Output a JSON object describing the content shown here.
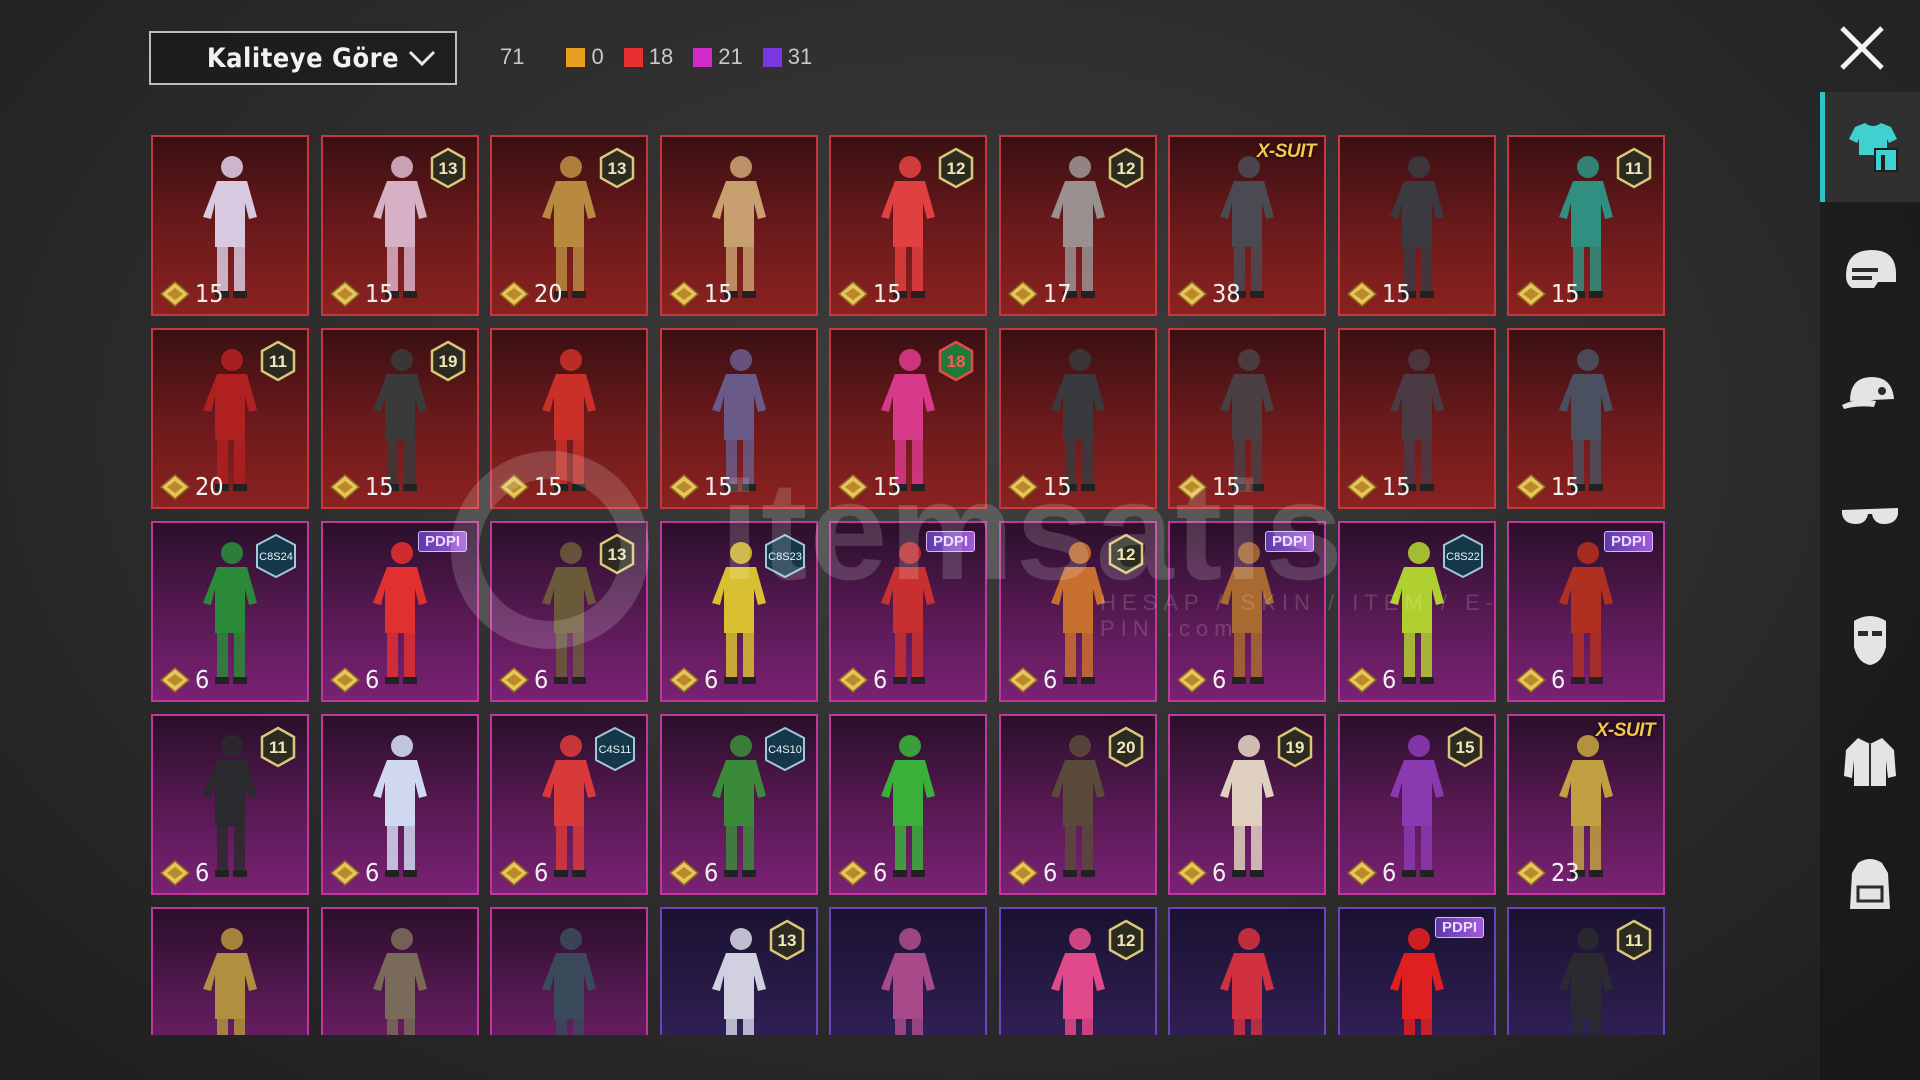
{
  "toolbar": {
    "sort_label": "Kaliteye Göre",
    "total_count": "71",
    "rarity_counts": [
      {
        "color": "#e8a020",
        "count": "0"
      },
      {
        "color": "#e83030",
        "count": "18"
      },
      {
        "color": "#d42ac8",
        "count": "21"
      },
      {
        "color": "#7a36e0",
        "count": "31"
      }
    ]
  },
  "watermark": {
    "brand": "itemsatis",
    "tagline": "HESAP / SKIN / ITEM / E-PIN .com"
  },
  "items": [
    {
      "rarity": "red",
      "price": "15",
      "badge": "",
      "figure": "#d9c9e0"
    },
    {
      "rarity": "red",
      "price": "15",
      "badge": "13",
      "figure": "#d8b0c6"
    },
    {
      "rarity": "red",
      "price": "20",
      "badge": "13",
      "figure": "#b88a40"
    },
    {
      "rarity": "red",
      "price": "15",
      "badge": "",
      "figure": "#c8a070"
    },
    {
      "rarity": "red",
      "price": "15",
      "badge": "12",
      "figure": "#e04040"
    },
    {
      "rarity": "red",
      "price": "17",
      "badge": "12",
      "figure": "#9a9090"
    },
    {
      "rarity": "red",
      "price": "38",
      "badge": "X-SUIT",
      "figure": "#4a4a52"
    },
    {
      "rarity": "red",
      "price": "15",
      "badge": "",
      "figure": "#3a3a40"
    },
    {
      "rarity": "red",
      "price": "15",
      "badge": "11",
      "figure": "#2f8f80"
    },
    {
      "rarity": "red",
      "price": "20",
      "badge": "11",
      "figure": "#b02020"
    },
    {
      "rarity": "red",
      "price": "15",
      "badge": "19",
      "figure": "#3a3a3a"
    },
    {
      "rarity": "red",
      "price": "15",
      "badge": "",
      "figure": "#c83028"
    },
    {
      "rarity": "red",
      "price": "15",
      "badge": "",
      "figure": "#6a5a8a"
    },
    {
      "rarity": "red",
      "price": "15",
      "badge": "18",
      "figure": "#d83a8a"
    },
    {
      "rarity": "red",
      "price": "15",
      "badge": "",
      "figure": "#3a3a3e"
    },
    {
      "rarity": "red",
      "price": "15",
      "badge": "",
      "figure": "#4a4044"
    },
    {
      "rarity": "red",
      "price": "15",
      "badge": "",
      "figure": "#4a3a44"
    },
    {
      "rarity": "red",
      "price": "15",
      "badge": "",
      "figure": "#4a5060"
    },
    {
      "rarity": "pink",
      "price": "6",
      "badge": "C8S24",
      "figure": "#2a8a3a"
    },
    {
      "rarity": "pink",
      "price": "6",
      "badge": "PDPI",
      "figure": "#e03030"
    },
    {
      "rarity": "pink",
      "price": "6",
      "badge": "13",
      "figure": "#6a5a3a"
    },
    {
      "rarity": "pink",
      "price": "6",
      "badge": "C8S23",
      "figure": "#d8c030"
    },
    {
      "rarity": "pink",
      "price": "6",
      "badge": "PDPI",
      "figure": "#c83030"
    },
    {
      "rarity": "pink",
      "price": "6",
      "badge": "12",
      "figure": "#c87030"
    },
    {
      "rarity": "pink",
      "price": "6",
      "badge": "PDPI",
      "figure": "#a86a30"
    },
    {
      "rarity": "pink",
      "price": "6",
      "badge": "C8S22",
      "figure": "#b0d030"
    },
    {
      "rarity": "pink",
      "price": "6",
      "badge": "PDPI",
      "figure": "#b03020"
    },
    {
      "rarity": "pink",
      "price": "6",
      "badge": "11",
      "figure": "#2a2a2e"
    },
    {
      "rarity": "pink",
      "price": "6",
      "badge": "",
      "figure": "#d0d8f0"
    },
    {
      "rarity": "pink",
      "price": "6",
      "badge": "C4S11",
      "figure": "#d83a3a"
    },
    {
      "rarity": "pink",
      "price": "6",
      "badge": "C4S10",
      "figure": "#3a8a3a"
    },
    {
      "rarity": "pink",
      "price": "6",
      "badge": "",
      "figure": "#3ab03a"
    },
    {
      "rarity": "pink",
      "price": "6",
      "badge": "20",
      "figure": "#5a4a3a"
    },
    {
      "rarity": "pink",
      "price": "6",
      "badge": "19",
      "figure": "#e0d0c0"
    },
    {
      "rarity": "pink",
      "price": "6",
      "badge": "15",
      "figure": "#8a3ab0"
    },
    {
      "rarity": "pink",
      "price": "23",
      "badge": "X-SUIT",
      "figure": "#c0a040"
    },
    {
      "rarity": "pink",
      "price": "",
      "badge": "",
      "figure": "#b09040"
    },
    {
      "rarity": "pink",
      "price": "",
      "badge": "",
      "figure": "#7a6a5a"
    },
    {
      "rarity": "pink",
      "price": "",
      "badge": "",
      "figure": "#3a4a5a"
    },
    {
      "rarity": "purple",
      "price": "",
      "badge": "13",
      "figure": "#d0d0e0"
    },
    {
      "rarity": "purple",
      "price": "",
      "badge": "",
      "figure": "#a84a8a"
    },
    {
      "rarity": "purple",
      "price": "",
      "badge": "12",
      "figure": "#e04a8a"
    },
    {
      "rarity": "purple",
      "price": "",
      "badge": "",
      "figure": "#d03040"
    },
    {
      "rarity": "purple",
      "price": "",
      "badge": "PDPI",
      "figure": "#e02020"
    },
    {
      "rarity": "purple",
      "price": "",
      "badge": "11",
      "figure": "#2a2a30"
    }
  ],
  "sidebar": [
    {
      "name": "outfit",
      "active": true
    },
    {
      "name": "helmet",
      "active": false
    },
    {
      "name": "cap",
      "active": false
    },
    {
      "name": "glasses",
      "active": false
    },
    {
      "name": "mask",
      "active": false
    },
    {
      "name": "jacket",
      "active": false
    },
    {
      "name": "backpack",
      "active": false
    }
  ]
}
